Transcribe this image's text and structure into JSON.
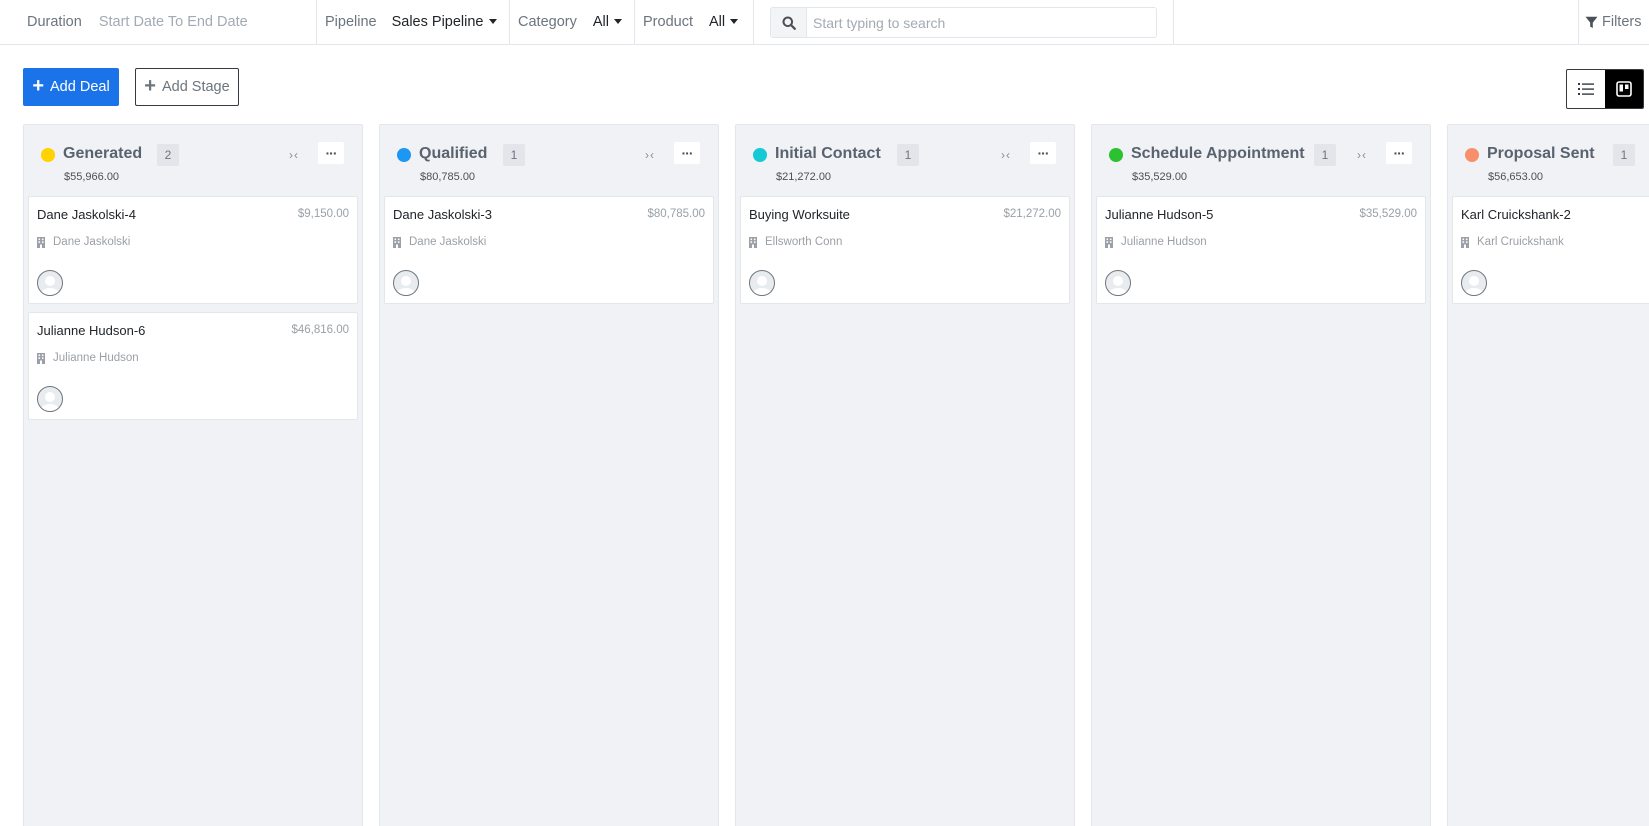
{
  "filters": {
    "duration_label": "Duration",
    "duration_placeholder": "Start Date To End Date",
    "pipeline_label": "Pipeline",
    "pipeline_value": "Sales Pipeline",
    "category_label": "Category",
    "category_value": "All",
    "product_label": "Product",
    "product_value": "All",
    "search_placeholder": "Start typing to search",
    "filters_label": "Filters"
  },
  "actions": {
    "add_deal_label": "Add Deal",
    "add_stage_label": "Add Stage",
    "view_mode": "kanban"
  },
  "stages": [
    {
      "name": "Generated",
      "count": "2",
      "total": "$55,966.00",
      "color": "#ffd200",
      "deals": [
        {
          "title": "Dane Jaskolski-4",
          "amount": "$9,150.00",
          "organization": "Dane Jaskolski"
        },
        {
          "title": "Julianne Hudson-6",
          "amount": "$46,816.00",
          "organization": "Julianne Hudson"
        }
      ]
    },
    {
      "name": "Qualified",
      "count": "1",
      "total": "$80,785.00",
      "color": "#1d97f4",
      "deals": [
        {
          "title": "Dane Jaskolski-3",
          "amount": "$80,785.00",
          "organization": "Dane Jaskolski"
        }
      ]
    },
    {
      "name": "Initial Contact",
      "count": "1",
      "total": "$21,272.00",
      "color": "#16c9d5",
      "deals": [
        {
          "title": "Buying Worksuite",
          "amount": "$21,272.00",
          "organization": "Ellsworth Conn"
        }
      ]
    },
    {
      "name": "Schedule Appointment",
      "count": "1",
      "total": "$35,529.00",
      "color": "#2cc131",
      "deals": [
        {
          "title": "Julianne Hudson-5",
          "amount": "$35,529.00",
          "organization": "Julianne Hudson"
        }
      ]
    },
    {
      "name": "Proposal Sent",
      "count": "1",
      "total": "$56,653.00",
      "color": "#f88f6b",
      "deals": [
        {
          "title": "Karl Cruickshank-2",
          "amount": "",
          "organization": "Karl Cruickshank"
        }
      ]
    }
  ]
}
